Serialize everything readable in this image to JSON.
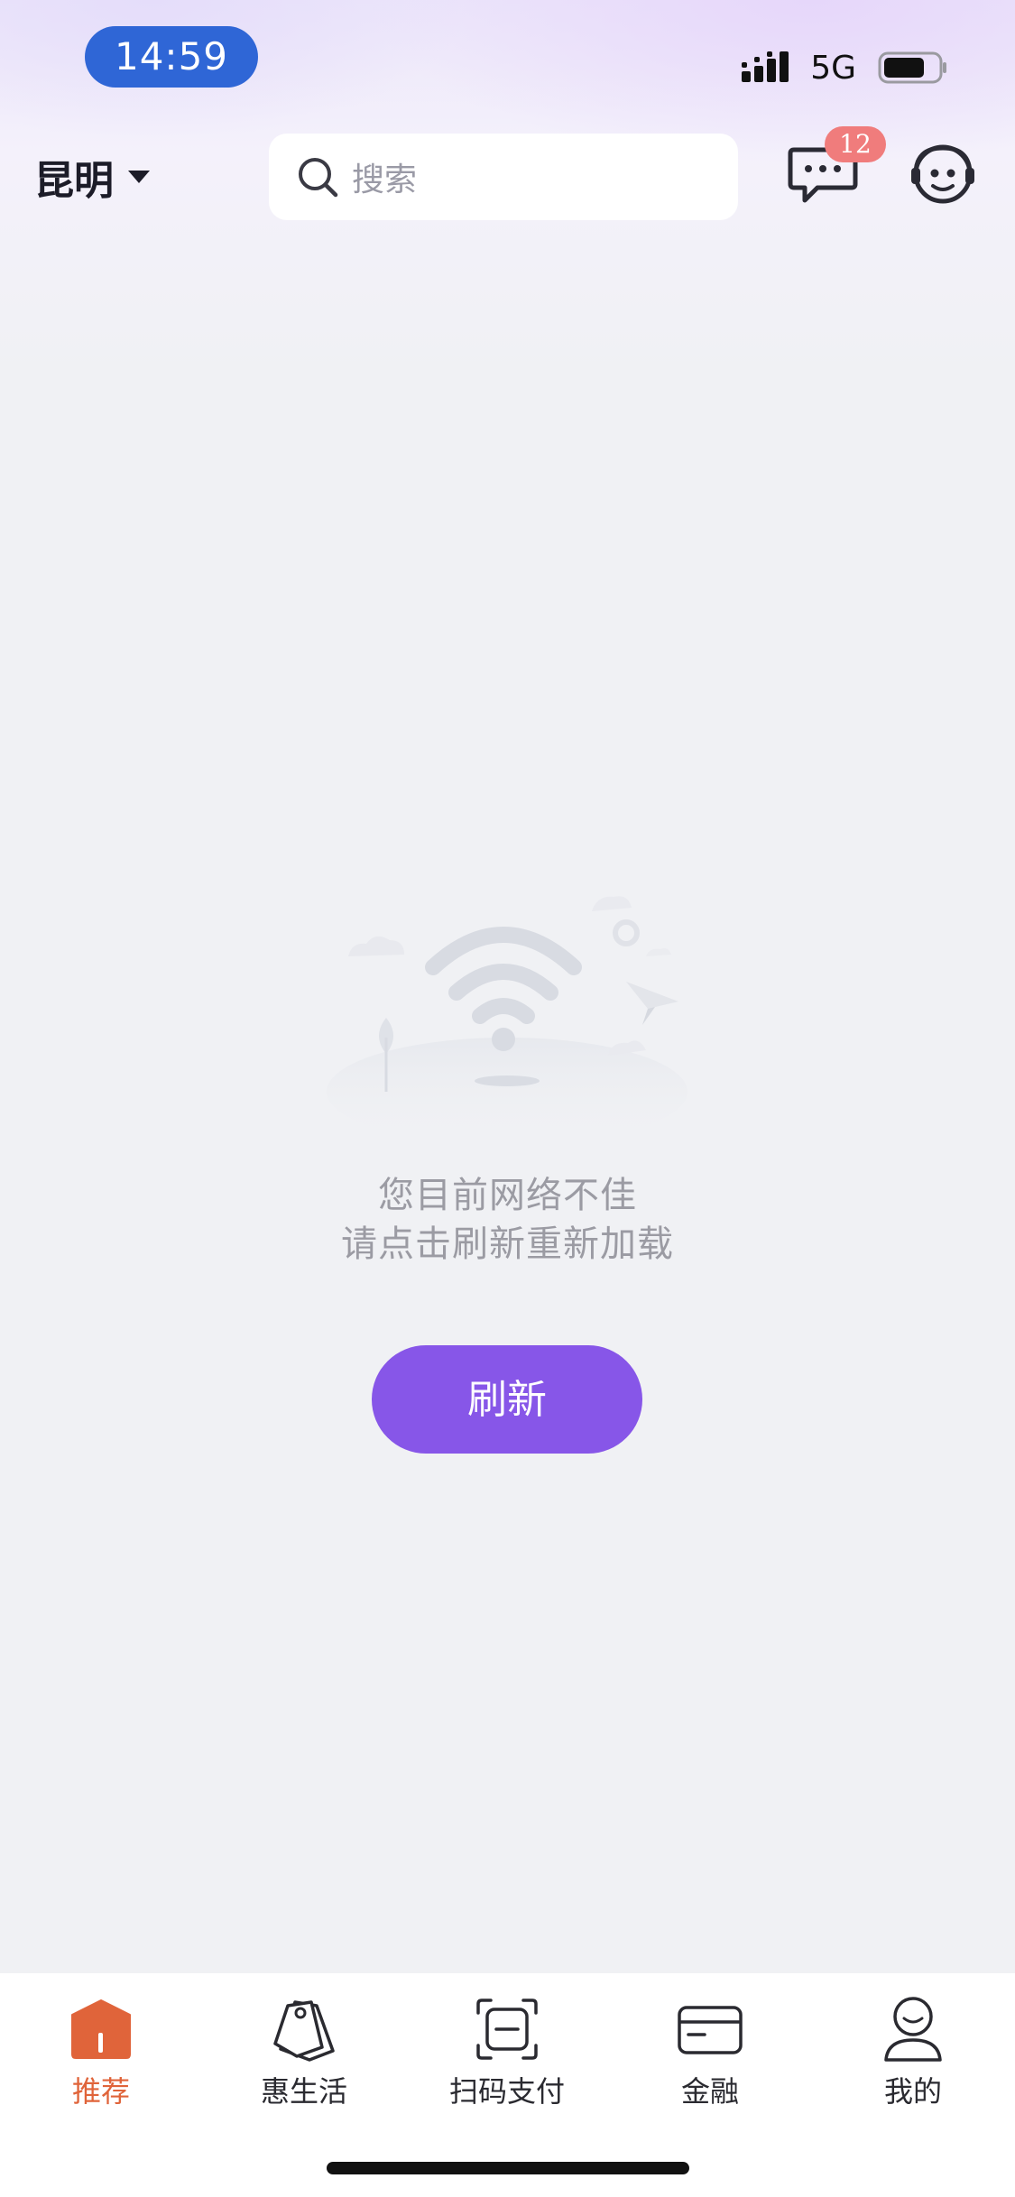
{
  "status_bar": {
    "time": "14:59",
    "network": "5G",
    "icons": [
      "signal-icon",
      "battery-icon"
    ]
  },
  "header": {
    "city": "昆明",
    "search_placeholder": "搜索",
    "message_badge": "12",
    "icons": [
      "caret-down-icon",
      "search-icon",
      "message-icon",
      "customer-service-icon"
    ]
  },
  "empty_state": {
    "line1": "您目前网络不佳",
    "line2": "请点击刷新重新加载",
    "refresh_label": "刷新",
    "illustration": "no-network-illustration"
  },
  "tabs": [
    {
      "label": "推荐",
      "icon": "home-icon",
      "active": true
    },
    {
      "label": "惠生活",
      "icon": "tags-icon",
      "active": false
    },
    {
      "label": "扫码支付",
      "icon": "scan-icon",
      "active": false
    },
    {
      "label": "金融",
      "icon": "card-icon",
      "active": false
    },
    {
      "label": "我的",
      "icon": "profile-icon",
      "active": false
    }
  ],
  "colors": {
    "accent_purple": "#8756e8",
    "active_tab": "#e0643a",
    "time_pill": "#2f66d6",
    "badge": "#f07c7c",
    "background": "#f0f1f4"
  }
}
